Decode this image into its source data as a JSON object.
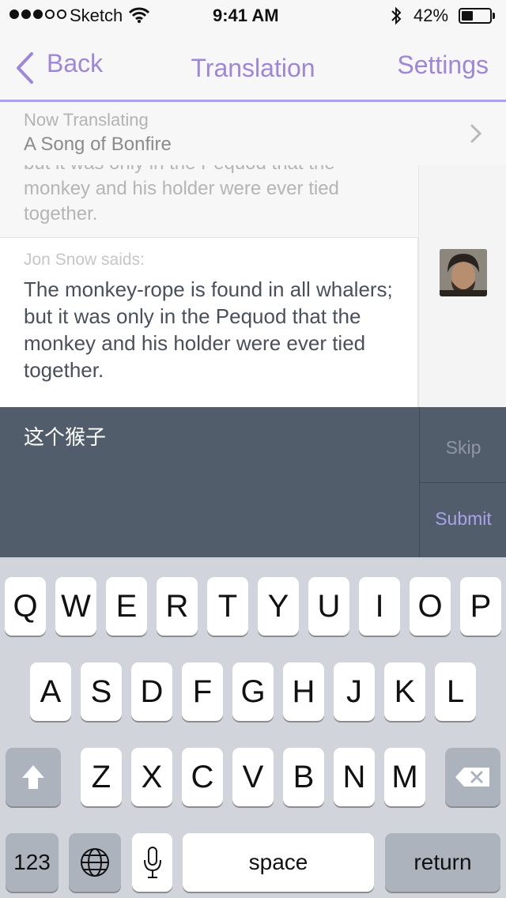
{
  "status_bar": {
    "carrier": "Sketch",
    "time": "9:41 AM",
    "battery": "42%",
    "signal_bars": 3,
    "battery_level": 0.42
  },
  "nav": {
    "back_label": "Back",
    "title": "Translation",
    "settings_label": "Settings"
  },
  "now_translating": {
    "label": "Now Translating",
    "book": "A Song of Bonfire"
  },
  "chat": {
    "previous_message": "but it was only in the Pequod that the monkey and his holder were ever tied together.",
    "message_author": "Jon Snow saids:",
    "message_text": "The monkey-rope is found in all whalers; but it was only in the Pequod that the monkey and his holder were ever tied together."
  },
  "input": {
    "value": "这个猴子",
    "skip_label": "Skip",
    "submit_label": "Submit"
  },
  "keyboard": {
    "row1": [
      "Q",
      "W",
      "E",
      "R",
      "T",
      "Y",
      "U",
      "I",
      "O",
      "P"
    ],
    "row2": [
      "A",
      "S",
      "D",
      "F",
      "G",
      "H",
      "J",
      "K",
      "L"
    ],
    "row3": [
      "Z",
      "X",
      "C",
      "V",
      "B",
      "N",
      "M"
    ],
    "numbers_label": "123",
    "space_label": "space",
    "return_label": "return"
  },
  "colors": {
    "accent": "#9d87d6",
    "input_background": "#525d6c",
    "keyboard_background": "#d1d5db"
  }
}
